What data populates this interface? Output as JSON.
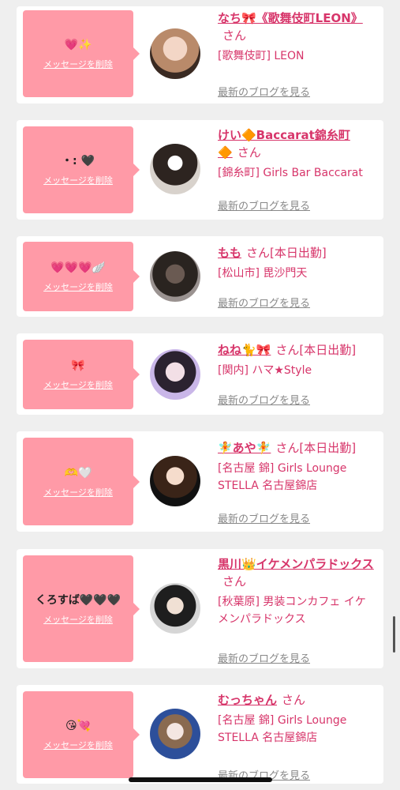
{
  "delete_label": "メッセージを削除",
  "san_label": "さん",
  "blog_label": "最新のブログを見る",
  "colors": {
    "pink_bubble": "#ff9aa7",
    "accent": "#d7356a",
    "link_gray": "#888888",
    "background": "#efefef"
  },
  "items": [
    {
      "message": "💗✨",
      "name": "なち🎀《歌舞伎町LEON》",
      "status": "",
      "shop": "[歌舞伎町] LEON"
    },
    {
      "message": "・: 🖤",
      "name": "けい🔶Baccarat錦糸町🔶",
      "status": "",
      "shop": "[錦糸町] Girls Bar Baccarat"
    },
    {
      "message": "💗💗💗🪽",
      "name": "もも",
      "status": "[本日出勤]",
      "shop": "[松山市] 毘沙門天"
    },
    {
      "message": "🎀",
      "name": "ねね🐈🎀",
      "status": "[本日出勤]",
      "shop": "[関内] ハマ★Style"
    },
    {
      "message": "🫶🤍",
      "name": "🧚あや🧚",
      "status": "[本日出勤]",
      "shop": "[名古屋 錦] Girls Lounge STELLA 名古屋錦店"
    },
    {
      "message": "くろすば🖤🖤🖤",
      "name": "黒川👑イケメンパラドックス",
      "status": "",
      "shop": "[秋葉原] 男装コンカフェ イケメンパラドックス"
    },
    {
      "message": "😘💘",
      "name": "むっちゃん",
      "status": "",
      "shop": "[名古屋 錦] Girls Lounge STELLA 名古屋錦店"
    }
  ]
}
